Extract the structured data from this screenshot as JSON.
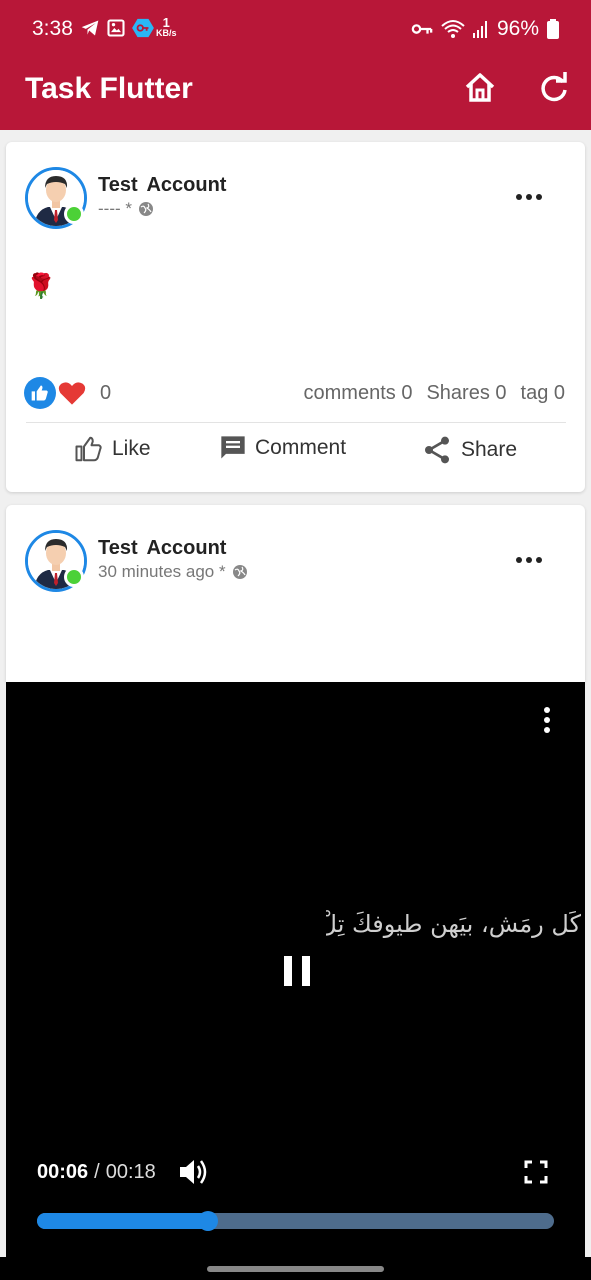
{
  "status_bar": {
    "time": "3:38",
    "net_speed_value": "1",
    "net_speed_unit": "KB/s",
    "battery": "96%",
    "left_icons": [
      "telegram-icon",
      "gallery-icon",
      "vpn-app-icon"
    ],
    "right_icons": [
      "vpn-key-icon",
      "wifi-icon",
      "signal-icon",
      "battery-icon"
    ]
  },
  "app_bar": {
    "title": "Task Flutter",
    "color": "#b81738"
  },
  "posts": [
    {
      "author": "Test  Account",
      "meta": "---- *",
      "content_emoji": "🌹",
      "reaction_count": "0",
      "comments": "comments 0",
      "shares": "Shares 0",
      "tags": "tag 0"
    },
    {
      "author": "Test  Account",
      "meta": "30 minutes ago *"
    }
  ],
  "actions": {
    "like": "Like",
    "comment": "Comment",
    "share": "Share"
  },
  "video": {
    "current_time": "00:06",
    "separator": "/",
    "duration": "00:18",
    "progress_fraction": 0.33,
    "caption": "كَل رمَش، بيَهن طيوفكَ تِلْ"
  },
  "colors": {
    "accent": "#b81738",
    "blue": "#1e88e5",
    "online": "#4cd137"
  }
}
